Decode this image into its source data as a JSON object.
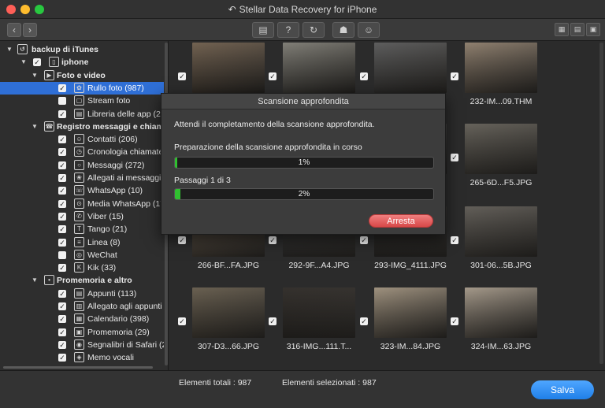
{
  "window": {
    "title": "Stellar Data Recovery for iPhone"
  },
  "toolbar": {
    "back_icon": "chevron-left-icon",
    "forward_icon": "chevron-right-icon",
    "buttons": [
      "save-icon",
      "help-icon",
      "refresh-icon",
      "cart-icon",
      "account-icon"
    ],
    "help_glyph": "?"
  },
  "sidebar": {
    "items": [
      {
        "label": "backup di iTunes",
        "level": 0,
        "checked": false,
        "selected": false,
        "bold": true
      },
      {
        "label": "iphone",
        "level": 1,
        "checked": true,
        "selected": false,
        "bold": true
      },
      {
        "label": "Foto e video",
        "level": 2,
        "checked": true,
        "selected": false,
        "bold": true
      },
      {
        "label": "Rullo foto (987)",
        "level": 3,
        "checked": true,
        "selected": true,
        "bold": false
      },
      {
        "label": "Stream foto",
        "level": 3,
        "checked": false,
        "selected": false,
        "bold": false
      },
      {
        "label": "Libreria delle app (280",
        "level": 3,
        "checked": true,
        "selected": false,
        "bold": false
      },
      {
        "label": "Registro messaggi e chiamat",
        "level": 2,
        "checked": false,
        "selected": false,
        "bold": true
      },
      {
        "label": "Contatti (206)",
        "level": 3,
        "checked": true,
        "selected": false,
        "bold": false
      },
      {
        "label": "Cronologia chiamate (",
        "level": 3,
        "checked": true,
        "selected": false,
        "bold": false
      },
      {
        "label": "Messaggi (272)",
        "level": 3,
        "checked": true,
        "selected": false,
        "bold": false
      },
      {
        "label": "Allegati ai messaggi (",
        "level": 3,
        "checked": true,
        "selected": false,
        "bold": false
      },
      {
        "label": "WhatsApp (10)",
        "level": 3,
        "checked": true,
        "selected": false,
        "bold": false
      },
      {
        "label": "Media WhatsApp (174",
        "level": 3,
        "checked": true,
        "selected": false,
        "bold": false
      },
      {
        "label": "Viber (15)",
        "level": 3,
        "checked": true,
        "selected": false,
        "bold": false
      },
      {
        "label": "Tango (21)",
        "level": 3,
        "checked": true,
        "selected": false,
        "bold": false
      },
      {
        "label": "Linea (8)",
        "level": 3,
        "checked": true,
        "selected": false,
        "bold": false
      },
      {
        "label": "WeChat",
        "level": 3,
        "checked": false,
        "selected": false,
        "bold": false
      },
      {
        "label": "Kik (33)",
        "level": 3,
        "checked": true,
        "selected": false,
        "bold": false
      },
      {
        "label": "Promemoria e altro",
        "level": 2,
        "checked": false,
        "selected": false,
        "bold": true
      },
      {
        "label": "Appunti (113)",
        "level": 3,
        "checked": true,
        "selected": false,
        "bold": false
      },
      {
        "label": "Allegato agli appunti (1",
        "level": 3,
        "checked": true,
        "selected": false,
        "bold": false
      },
      {
        "label": "Calendario (398)",
        "level": 3,
        "checked": true,
        "selected": false,
        "bold": false
      },
      {
        "label": "Promemoria (29)",
        "level": 3,
        "checked": true,
        "selected": false,
        "bold": false
      },
      {
        "label": "Segnalibri di Safari (22)",
        "level": 3,
        "checked": true,
        "selected": false,
        "bold": false
      },
      {
        "label": "Memo vocali",
        "level": 3,
        "checked": true,
        "selected": false,
        "bold": false
      }
    ],
    "icons": [
      "restore-icon",
      "phone-icon",
      "media-icon",
      "flower-icon",
      "stream-icon",
      "library-icon",
      "call-log-icon",
      "contacts-icon",
      "clock-icon",
      "chat-icon",
      "paperclip-icon",
      "whatsapp-icon",
      "whatsapp-media-icon",
      "viber-icon",
      "tango-icon",
      "line-icon",
      "wechat-icon",
      "kik-icon",
      "microphone-icon",
      "notes-icon",
      "note-attachment-icon",
      "calendar-icon",
      "reminder-icon",
      "safari-icon",
      "voice-memo-icon"
    ]
  },
  "grid": {
    "tiles": [
      {
        "name": "",
        "tone": "#6b5a48"
      },
      {
        "name": "",
        "tone": "#7a7870"
      },
      {
        "name": "",
        "tone": "#555"
      },
      {
        "name": "232-IM...09.THM",
        "tone": "#8a7a68"
      },
      {
        "name": "",
        "tone": "#3a3a3a"
      },
      {
        "name": "",
        "tone": "#3a3a3a"
      },
      {
        "name": "",
        "tone": "#3a3a3a"
      },
      {
        "name": "265-6D...F5.JPG",
        "tone": "#5e5a52"
      },
      {
        "name": "266-BF...FA.JPG",
        "tone": "#6e6050"
      },
      {
        "name": "292-9F...A4.JPG",
        "tone": "#383838"
      },
      {
        "name": "293-IMG_4111.JPG",
        "tone": "#2a2826"
      },
      {
        "name": "301-06...5B.JPG",
        "tone": "#5a5650"
      },
      {
        "name": "307-D3...66.JPG",
        "tone": "#625848"
      },
      {
        "name": "316-IMG...111.T...",
        "tone": "#2a2622"
      },
      {
        "name": "323-IM...84.JPG",
        "tone": "#9a8c78"
      },
      {
        "name": "324-IM...63.JPG",
        "tone": "#a09484"
      }
    ]
  },
  "dialog": {
    "title": "Scansione approfondita",
    "message": "Attendi il completamento della scansione approfondita.",
    "stage_label": "Preparazione della scansione approfondita in corso",
    "progress1": {
      "value": 1,
      "text": "1%"
    },
    "pass_label": "Passaggi 1 di 3",
    "progress2": {
      "value": 2,
      "text": "2%"
    },
    "stop_label": "Arresta"
  },
  "status": {
    "total": "Elementi totali : 987",
    "selected": "Elementi selezionati : 987",
    "save_label": "Salva"
  },
  "colors": {
    "accent": "#2f6fd6",
    "progress": "#30c030",
    "stop": "#d84848",
    "save": "#1f7fe8"
  }
}
